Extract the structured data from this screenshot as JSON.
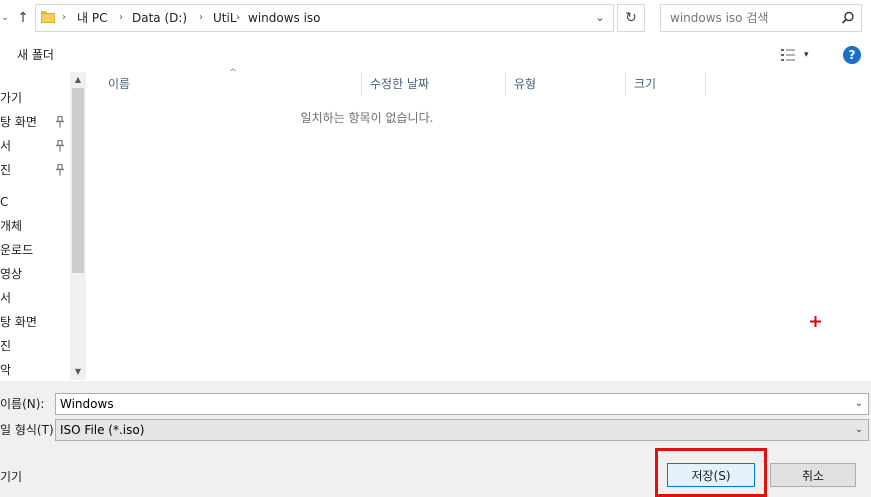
{
  "address": {
    "recent_chevron": "⌄",
    "up_arrow": "↑",
    "breadcrumbs": [
      "내 PC",
      "Data (D:)",
      "UtiL",
      "windows iso"
    ],
    "separator": "›",
    "dropdown": "⌄",
    "refresh": "↻"
  },
  "search": {
    "placeholder": "windows iso 검색"
  },
  "toolbar": {
    "new_folder": "새 폴더",
    "view_dropdown": "▾",
    "help": "?"
  },
  "sidebar": {
    "items": [
      "가기",
      "탕 화면",
      "서",
      "진",
      "C",
      "개체",
      "운로드",
      "영상",
      "서",
      "탕 화면",
      "진",
      "악"
    ],
    "pin_glyph": "📌",
    "scroll_up": "▲",
    "scroll_down": "▼"
  },
  "file_list": {
    "columns": [
      "이름",
      "수정한 날짜",
      "유형",
      "크기"
    ],
    "sort_indicator": "^",
    "empty_message": "일치하는 항목이 없습니다."
  },
  "bottom": {
    "filename_label": "이름(N):",
    "filename_value": "Windows",
    "filetype_label": "일 형식(T):",
    "filetype_value": "ISO File (*.iso)",
    "hide_folders": "기기",
    "save": "저장(S)",
    "cancel": "취소",
    "chevron": "⌄"
  },
  "colors": {
    "accent": "#0078d7",
    "highlight": "#e01010",
    "help": "#1a6fc9"
  }
}
